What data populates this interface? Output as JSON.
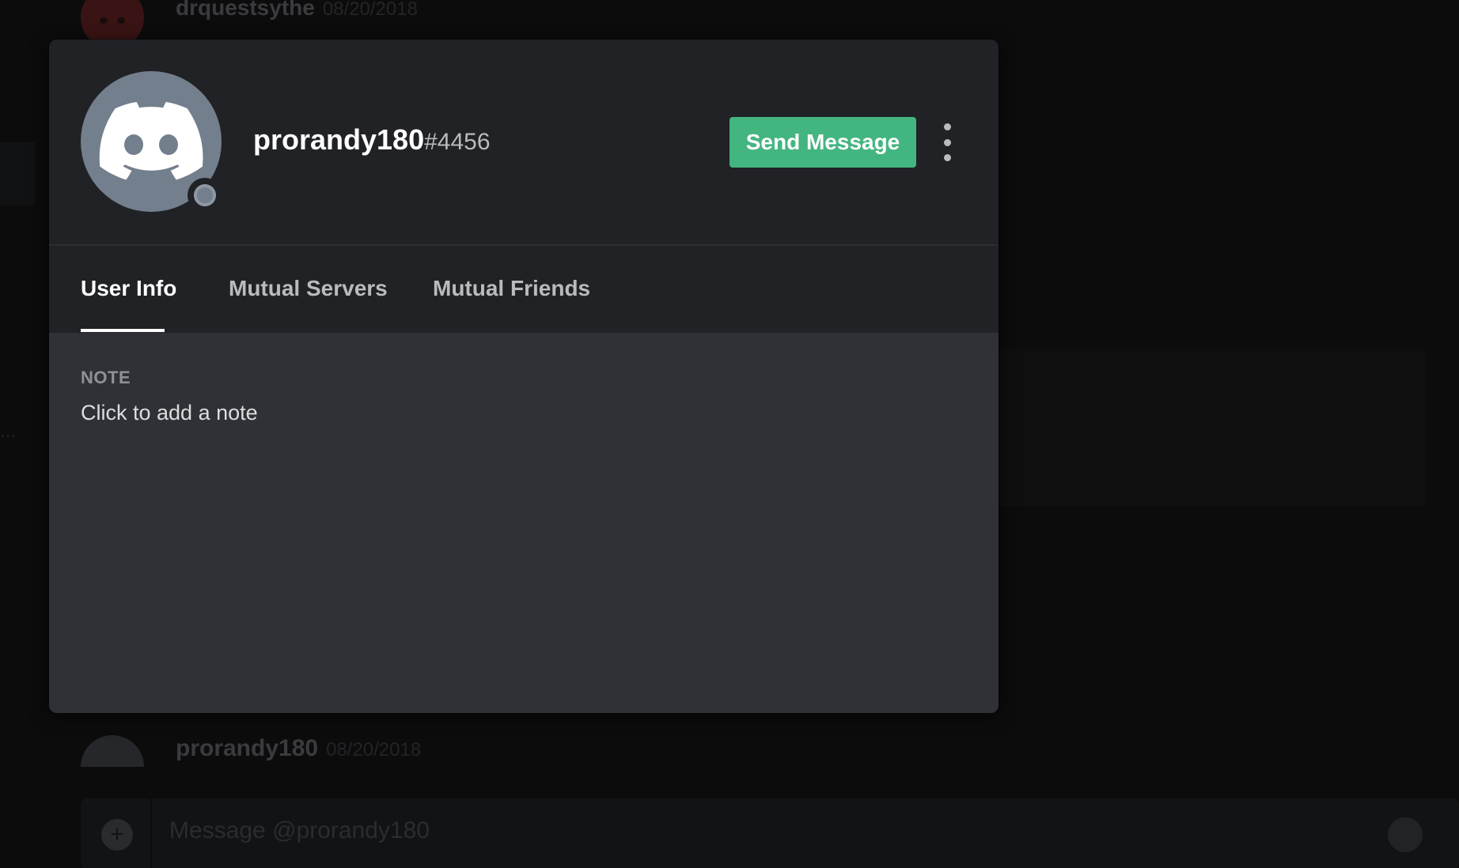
{
  "background": {
    "top_message": {
      "author": "drquestsythe",
      "timestamp": "08/20/2018"
    },
    "bottom_message": {
      "author": "prorandy180",
      "timestamp": "08/20/2018"
    },
    "composer": {
      "placeholder": "Message @prorandy180"
    }
  },
  "profile": {
    "username": "prorandy180",
    "discriminator": "#4456",
    "send_message_label": "Send Message",
    "avatar_icon": "discord-logo-icon",
    "status": "offline",
    "status_color": "#747f8d",
    "accent_button_color": "#43b581"
  },
  "tabs": [
    {
      "label": "User Info",
      "active": true
    },
    {
      "label": "Mutual Servers",
      "active": false
    },
    {
      "label": "Mutual Friends",
      "active": false
    }
  ],
  "user_info": {
    "note_label": "NOTE",
    "note_placeholder": "Click to add a note"
  }
}
